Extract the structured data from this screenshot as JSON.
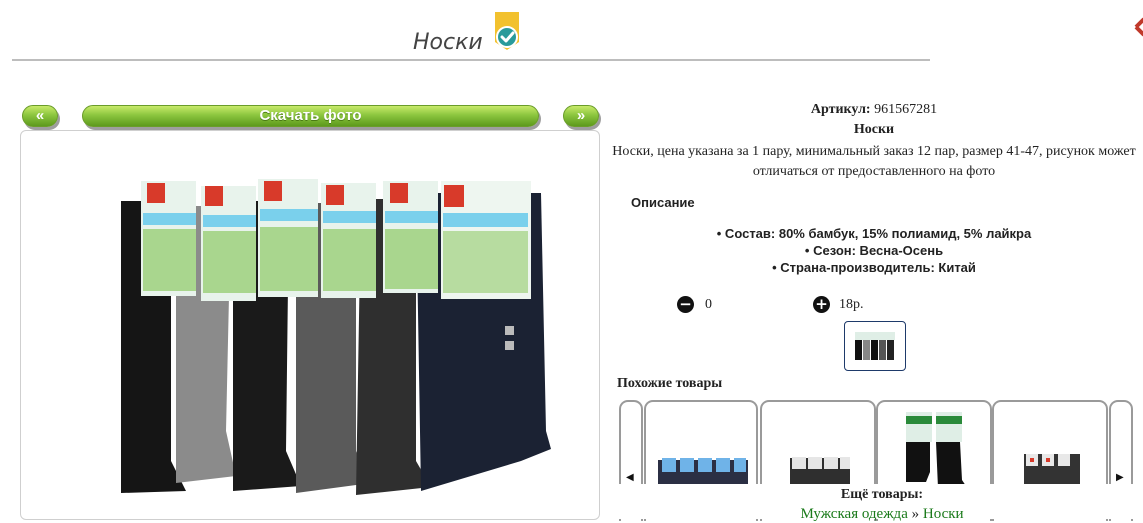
{
  "header": {
    "title": "Носки"
  },
  "photo_nav": {
    "prev_label": "«",
    "download_label": "Скачать фото",
    "next_label": "»"
  },
  "product": {
    "sku_label": "Артикул:",
    "sku_value": "961567281",
    "name": "Носки",
    "description": "Носки, цена указана за 1 пару, минимальный заказ 12 пар, размер 41-47, рисунок может отличаться от предоставленного на фото",
    "desc_heading": "Описание",
    "attributes": [
      "• Состав: 80% бамбук, 15% полиамид, 5% лайкра",
      "• Сезон: Весна-Осень",
      "• Страна-производитель: Китай"
    ]
  },
  "order": {
    "minus_label": "−",
    "quantity": "0",
    "plus_label": "+",
    "price": "18р."
  },
  "similar": {
    "heading": "Похожие товары",
    "left_arrow": "◀",
    "right_arrow": "▶"
  },
  "more": {
    "heading": "Ещё товары:",
    "link_1": "Мужская одежда",
    "separator": " » ",
    "link_2": "Носки"
  },
  "colors": {
    "accent_green": "#8cc63f",
    "link_green": "#1a7a1a",
    "badge_yellow": "#f2c12e",
    "badge_teal": "#2a9a9a"
  },
  "icons": [
    "verified-badge-icon",
    "minus-circle-icon",
    "plus-circle-icon",
    "chevron-left-icon",
    "chevron-right-icon"
  ]
}
